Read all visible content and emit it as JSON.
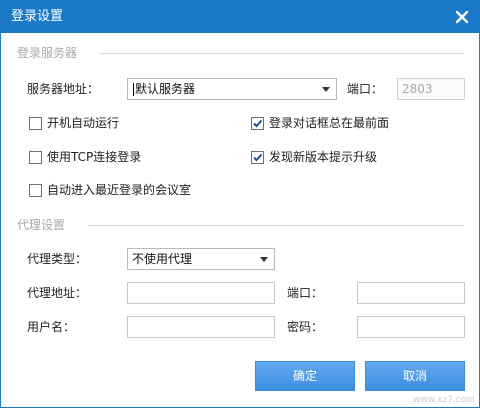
{
  "window": {
    "title": "登录设置"
  },
  "server_section": {
    "heading": "登录服务器",
    "server_label": "服务器地址：",
    "server_value": "默认服务器",
    "port_label": "端口：",
    "port_value": "2803"
  },
  "options": [
    {
      "label": "开机自动运行",
      "checked": false
    },
    {
      "label": "登录对话框总在最前面",
      "checked": true
    },
    {
      "label": "使用TCP连接登录",
      "checked": false
    },
    {
      "label": "发现新版本提示升级",
      "checked": true
    },
    {
      "label": "自动进入最近登录的会议室",
      "checked": false
    }
  ],
  "proxy_section": {
    "heading": "代理设置",
    "type_label": "代理类型：",
    "type_value": "不使用代理",
    "address_label": "代理地址：",
    "address_value": "",
    "port_label": "端口：",
    "port_value": "",
    "user_label": "用户名：",
    "user_value": "",
    "password_label": "密码：",
    "password_value": ""
  },
  "buttons": {
    "ok": "确定",
    "cancel": "取消"
  },
  "watermark": "www.xz7.com",
  "colors": {
    "accent": "#1a79c8",
    "button": "#4a96e4",
    "checkbox_check": "#1f4f8a"
  }
}
